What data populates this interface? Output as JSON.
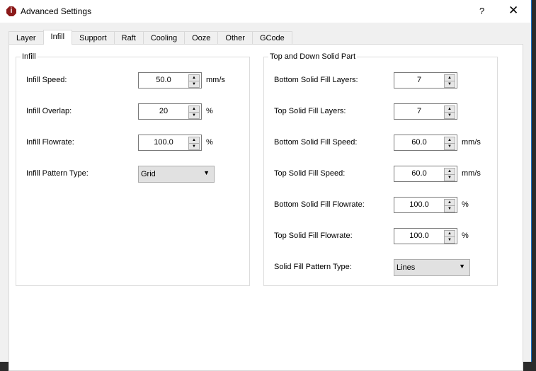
{
  "window": {
    "title": "Advanced Settings",
    "help": "?",
    "close": "✕"
  },
  "tabs": [
    "Layer",
    "Infill",
    "Support",
    "Raft",
    "Cooling",
    "Ooze",
    "Other",
    "GCode"
  ],
  "active_tab": "Infill",
  "infill": {
    "title": "Infill",
    "rows": [
      {
        "label": "Infill Speed:",
        "value": "50.0",
        "unit": "mm/s"
      },
      {
        "label": "Infill Overlap:",
        "value": "20",
        "unit": "%"
      },
      {
        "label": "Infill Flowrate:",
        "value": "100.0",
        "unit": "%"
      }
    ],
    "pattern_label": "Infill Pattern Type:",
    "pattern_value": "Grid"
  },
  "solid": {
    "title": "Top and Down Solid Part",
    "rows": [
      {
        "label": "Bottom Solid Fill Layers:",
        "value": "7",
        "unit": ""
      },
      {
        "label": "Top Solid Fill Layers:",
        "value": "7",
        "unit": ""
      },
      {
        "label": "Bottom Solid Fill Speed:",
        "value": "60.0",
        "unit": "mm/s"
      },
      {
        "label": "Top Solid Fill Speed:",
        "value": "60.0",
        "unit": "mm/s"
      },
      {
        "label": "Bottom Solid Fill Flowrate:",
        "value": "100.0",
        "unit": "%"
      },
      {
        "label": "Top Solid Fill Flowrate:",
        "value": "100.0",
        "unit": "%"
      }
    ],
    "pattern_label": "Solid Fill Pattern Type:",
    "pattern_value": "Lines"
  }
}
